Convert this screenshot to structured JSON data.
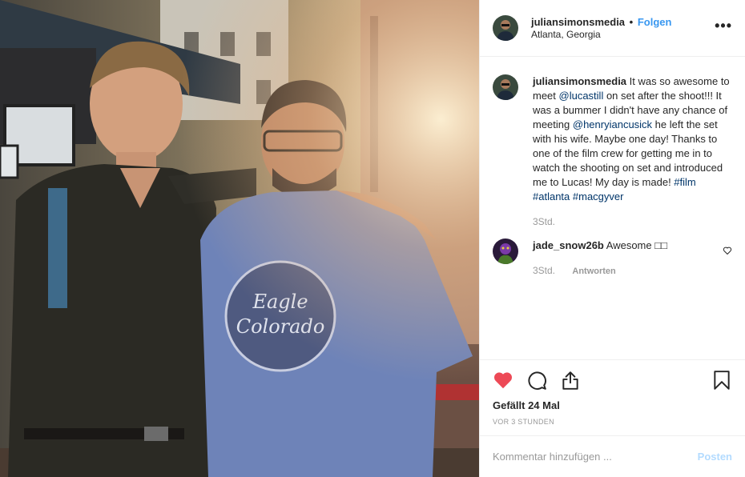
{
  "header": {
    "username": "juliansimonsmedia",
    "separator": "•",
    "follow_label": "Folgen",
    "location": "Atlanta, Georgia",
    "more_label": "•••"
  },
  "caption": {
    "username": "juliansimonsmedia",
    "text_1": " It was so awesome to meet ",
    "mention_1": "@lucastill",
    "text_2": " on set after the shoot!!! It was a bummer I didn't have any chance of meeting ",
    "mention_2": "@henryiancusick",
    "text_3": " he left the set with his wife. Maybe one day! Thanks to one of the film crew for getting me in to watch the shooting on set and introduced me to Lucas! My day is made! ",
    "hashtag_1": "#film",
    "hashtag_2": "#atlanta",
    "hashtag_3": "#macgyver",
    "time": "3Std."
  },
  "comments": [
    {
      "username": "jade_snow26b",
      "text": " Awesome □□",
      "time": "3Std.",
      "reply_label": "Antworten"
    }
  ],
  "actions": {
    "like_icon": "heart-filled-icon",
    "comment_icon": "comment-icon",
    "share_icon": "share-icon",
    "save_icon": "bookmark-icon",
    "like_color": "#ed4956",
    "likes_text": "Gefällt 24 Mal",
    "posted_ago": "VOR 3 STUNDEN"
  },
  "add_comment": {
    "placeholder": "Kommentar hinzufügen ...",
    "post_label": "Posten"
  },
  "colors": {
    "link": "#003569",
    "follow": "#3897f0",
    "post_disabled": "#b3dbff",
    "muted": "#999999"
  }
}
